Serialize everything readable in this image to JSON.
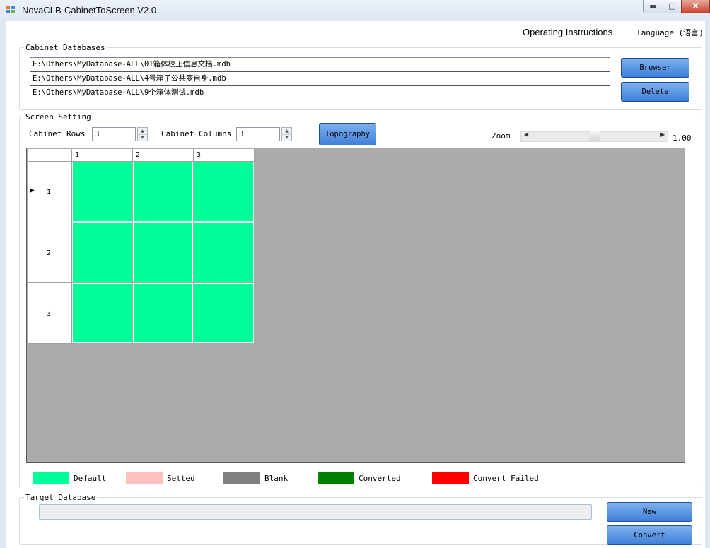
{
  "window": {
    "title": "NovaCLB-CabinetToScreen V2.0"
  },
  "menu": {
    "operating_instructions": "Operating Instructions",
    "language": "language (语言)"
  },
  "cabinet_databases": {
    "label": "Cabinet Databases",
    "files": [
      "E:\\Others\\MyDatabase-ALL\\01箱体校正信息文档.mdb",
      "E:\\Others\\MyDatabase-ALL\\4号箱子公共变自身.mdb",
      "E:\\Others\\MyDatabase-ALL\\9个箱体测试.mdb"
    ],
    "browser_label": "Browser",
    "delete_label": "Delete"
  },
  "screen_setting": {
    "label": "Screen Setting",
    "rows_label": "Cabinet Rows",
    "rows_value": "3",
    "cols_label": "Cabinet Columns",
    "cols_value": "3",
    "topography_label": "Topography",
    "zoom_label": "Zoom",
    "zoom_value": "1.00",
    "zoom_level": 0.5
  },
  "grid": {
    "columns": [
      "1",
      "2",
      "3"
    ],
    "rows": [
      "1",
      "2",
      "3"
    ],
    "selected_row": "1",
    "cell_state": "Default"
  },
  "legend": [
    {
      "label": "Default",
      "color": "#00ff99"
    },
    {
      "label": "Setted",
      "color": "#ffc0c0"
    },
    {
      "label": "Blank",
      "color": "#808080"
    },
    {
      "label": "Converted",
      "color": "#008000"
    },
    {
      "label": "Convert Failed",
      "color": "#ff0000"
    }
  ],
  "target_database": {
    "label": "Target Database",
    "value": "",
    "new_label": "New",
    "convert_label": "Convert"
  },
  "colors": {
    "cell_default": "#00ff99",
    "grid_bg": "#ababab",
    "button_blue": "#5b93e3"
  }
}
